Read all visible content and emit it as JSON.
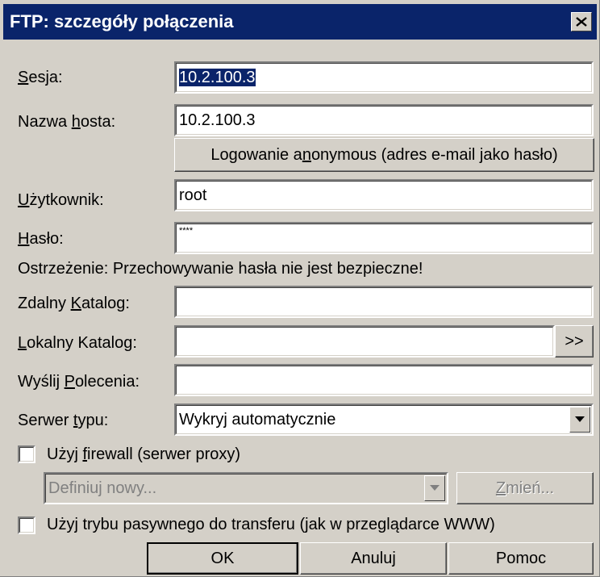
{
  "window": {
    "title": "FTP: szczegóły połączenia"
  },
  "fields": {
    "session": {
      "label": "Sesja:",
      "value": "10.2.100.3"
    },
    "hostname": {
      "label": "Nazwa hosta:",
      "value": "10.2.100.3"
    },
    "anonymous_button": "Logowanie anonymous (adres e-mail jako hasło)",
    "user": {
      "label": "Użytkownik:",
      "value": "root"
    },
    "password": {
      "label": "Hasło:",
      "value": "****"
    },
    "warning": "Ostrzeżenie: Przechowywanie hasła nie jest bezpieczne!",
    "remote_dir": {
      "label": "Zdalny Katalog:",
      "value": ""
    },
    "local_dir": {
      "label": "Lokalny Katalog:",
      "value": "",
      "browse_label": ">>"
    },
    "send_commands": {
      "label": "Wyślij Polecenia:",
      "value": ""
    },
    "server_type": {
      "label": "Serwer typu:",
      "value": "Wykryj automatycznie"
    }
  },
  "firewall": {
    "checkbox_label": "Użyj firewall (serwer proxy)",
    "checked": false,
    "proxy_select": "Definiuj nowy...",
    "change_label": "Zmień..."
  },
  "passive": {
    "checkbox_label": "Użyj trybu pasywnego do transferu (jak w przeglądarce WWW)",
    "checked": false
  },
  "buttons": {
    "ok": "OK",
    "cancel": "Anuluj",
    "help": "Pomoc"
  },
  "colors": {
    "title_bg": "#0a246a",
    "dialog_bg": "#d4d0c8",
    "selection_bg": "#0a246a"
  }
}
